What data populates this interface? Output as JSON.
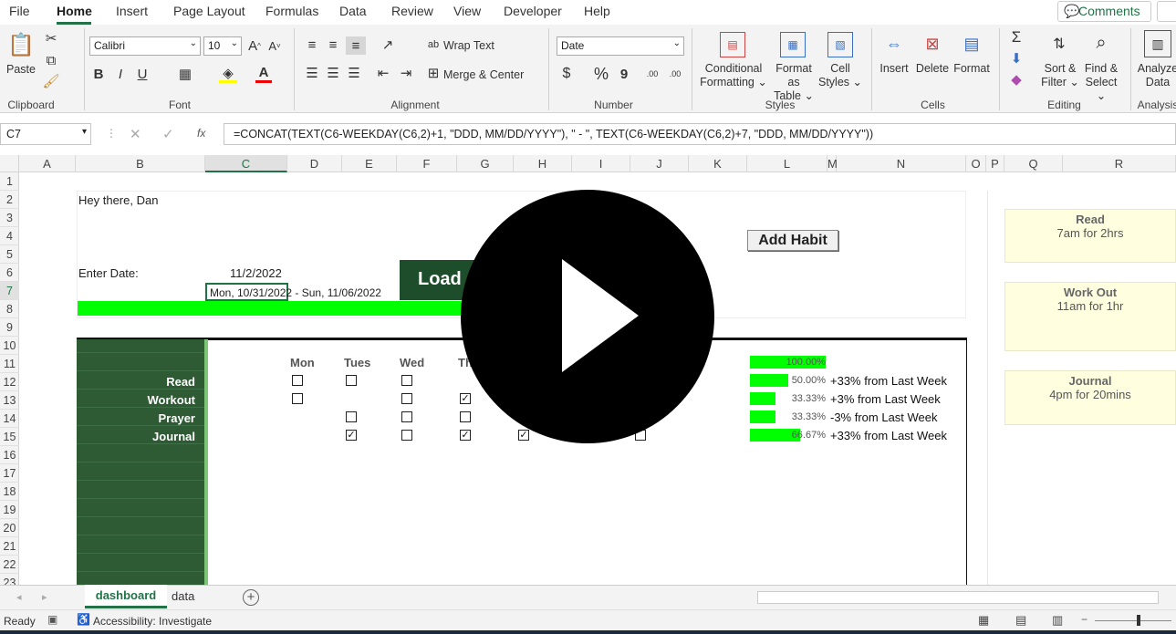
{
  "menu": {
    "items": [
      "File",
      "Home",
      "Insert",
      "Page Layout",
      "Formulas",
      "Data",
      "Review",
      "View",
      "Developer",
      "Help"
    ],
    "active": "Home",
    "comments": "Comments"
  },
  "ribbon": {
    "clipboard": {
      "label": "Clipboard",
      "paste": "Paste"
    },
    "font": {
      "label": "Font",
      "name": "Calibri",
      "size": "10",
      "bold": "B",
      "italic": "I",
      "underline": "U"
    },
    "alignment": {
      "label": "Alignment",
      "wrap": "Wrap Text",
      "merge": "Merge & Center"
    },
    "number": {
      "label": "Number",
      "format": "Date",
      "currency": "$",
      "percent": "%",
      "comma": "9",
      "inc": ".00",
      "dec": ".00"
    },
    "styles": {
      "label": "Styles",
      "conditional": "Conditional",
      "conditional2": "Formatting",
      "format_table": "Format as",
      "format_table2": "Table",
      "cell_styles": "Cell",
      "cell_styles2": "Styles"
    },
    "cells": {
      "label": "Cells",
      "insert": "Insert",
      "delete": "Delete",
      "format": "Format"
    },
    "editing": {
      "label": "Editing",
      "sort": "Sort &",
      "sort2": "Filter",
      "find": "Find &",
      "find2": "Select",
      "sigma": "Σ"
    },
    "analysis": {
      "label": "Analysis",
      "analyze": "Analyze",
      "analyze2": "Data"
    }
  },
  "formula_bar": {
    "name_box": "C7",
    "fx": "fx",
    "formula": "=CONCAT(TEXT(C6-WEEKDAY(C6,2)+1, \"DDD, MM/DD/YYYY\"), \" - \", TEXT(C6-WEEKDAY(C6,2)+7, \"DDD, MM/DD/YYYY\"))"
  },
  "columns": [
    "A",
    "B",
    "C",
    "D",
    "E",
    "F",
    "G",
    "H",
    "I",
    "J",
    "K",
    "L",
    "M",
    "N",
    "O",
    "P",
    "Q",
    "R"
  ],
  "rows": [
    "1",
    "2",
    "3",
    "4",
    "5",
    "6",
    "7",
    "8",
    "9",
    "10",
    "11",
    "12",
    "13",
    "14",
    "15",
    "16",
    "17",
    "18",
    "19",
    "20",
    "21",
    "22",
    "23"
  ],
  "dashboard": {
    "greeting": "Hey there, Dan",
    "enter_date_label": "Enter Date:",
    "date_value": "11/2/2022",
    "week_range": "Mon, 10/31/2022 - Sun, 11/06/2022",
    "load_button": "Load",
    "add_habit_button": "Add Habit",
    "days": [
      "Mon",
      "Tues",
      "Wed",
      "Th"
    ],
    "day_s": "S",
    "habits": [
      {
        "name": "Read",
        "checks": [
          false,
          false,
          false
        ],
        "progress": 0.5,
        "pct": "50.00%",
        "compare": "+33% from Last Week"
      },
      {
        "name": "Workout",
        "checks": [
          false,
          null,
          false,
          true
        ],
        "progress": 0.3333,
        "pct": "33.33%",
        "compare": "+3% from Last Week"
      },
      {
        "name": "Prayer",
        "checks": [
          null,
          false,
          false,
          false
        ],
        "progress": 0.3333,
        "pct": "33.33%",
        "compare": "-3% from Last Week"
      },
      {
        "name": "Journal",
        "checks": [
          null,
          true,
          false,
          true,
          true
        ],
        "progress": 0.6667,
        "pct": "66.67%",
        "compare": "+33% from Last Week"
      }
    ],
    "total": {
      "progress": 1.0,
      "pct": "100.00%"
    }
  },
  "schedule": [
    {
      "title": "Read",
      "time": "7am for 2hrs"
    },
    {
      "title": "Work Out",
      "time": "11am for 1hr"
    },
    {
      "title": "Journal",
      "time": "4pm for 20mins"
    }
  ],
  "tabs": {
    "active": "dashboard",
    "other": "data"
  },
  "status": {
    "ready": "Ready",
    "accessibility": "Accessibility: Investigate"
  },
  "colors": {
    "accent": "#217346",
    "load_bg": "#1e4d2b",
    "sidebar": "#2e5b34",
    "bar": "#00ff00",
    "card": "#ffffe0"
  }
}
